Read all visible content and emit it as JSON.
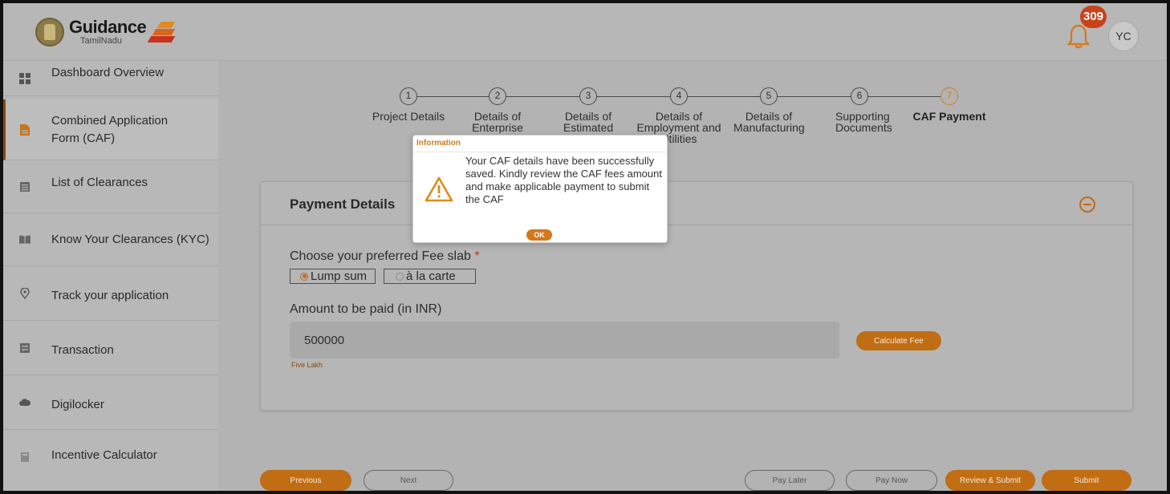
{
  "header": {
    "logo_main": "Guidance",
    "logo_sub": "TamilNadu",
    "notification_count": "309",
    "avatar_initials": "YC"
  },
  "sidebar": {
    "items": [
      {
        "label": "Dashboard Overview",
        "icon": "grid-icon"
      },
      {
        "label": "Combined Application Form (CAF)",
        "icon": "document-icon",
        "active": true
      },
      {
        "label": "List of Clearances",
        "icon": "list-icon"
      },
      {
        "label": "Know Your Clearances (KYC)",
        "icon": "book-icon"
      },
      {
        "label": "Track your application",
        "icon": "location-pin-icon"
      },
      {
        "label": "Transaction",
        "icon": "transaction-icon"
      },
      {
        "label": "Digilocker",
        "icon": "cloud-icon"
      },
      {
        "label": "Incentive Calculator",
        "icon": "calculator-icon"
      }
    ]
  },
  "stepper": {
    "steps": [
      {
        "num": "1",
        "label": "Project Details"
      },
      {
        "num": "2",
        "label": "Details of Enterprise"
      },
      {
        "num": "3",
        "label": "Details of Estimated"
      },
      {
        "num": "4",
        "label": "Details of Employment and Utilities"
      },
      {
        "num": "5",
        "label": "Details of Manufacturing"
      },
      {
        "num": "6",
        "label": "Supporting Documents"
      },
      {
        "num": "7",
        "label": "CAF Payment",
        "current": true
      }
    ]
  },
  "payment": {
    "title": "Payment Details",
    "fee_slab_label": "Choose your preferred Fee slab",
    "required_mark": "*",
    "options": [
      "Lump sum",
      "à la carte"
    ],
    "selected_option": "Lump sum",
    "amount_label": "Amount to be paid (in INR)",
    "amount_value": "500000",
    "amount_words": "Five Lakh",
    "calculate_label": "Calculate Fee"
  },
  "footer": {
    "previous": "Previous",
    "next": "Next",
    "pay_later": "Pay Later",
    "pay_now": "Pay Now",
    "review_submit": "Review & Submit",
    "submit": "Submit"
  },
  "dialog": {
    "title": "Information",
    "message": "Your CAF details have been successfully saved. Kindly review the CAF fees amount and make applicable payment to submit the CAF",
    "ok": "OK"
  },
  "colors": {
    "accent": "#c06d14",
    "badge": "#c8421c",
    "dialog_title": "#d47a1a"
  }
}
